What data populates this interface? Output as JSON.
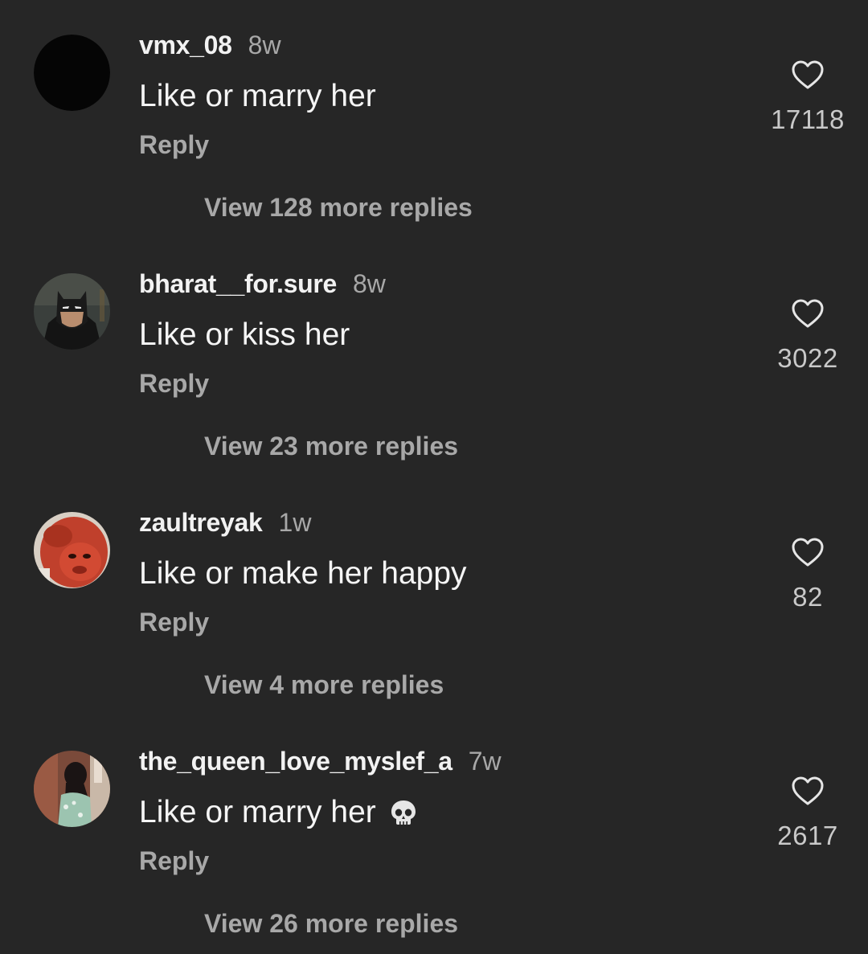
{
  "comments": [
    {
      "username": "vmx_08",
      "time": "8w",
      "text": "Like or marry her",
      "reply_label": "Reply",
      "likes": "17118",
      "more_replies": "View 128 more replies",
      "avatar": "black-circle-avatar",
      "emoji": ""
    },
    {
      "username": "bharat__for.sure",
      "time": "8w",
      "text": "Like or kiss her",
      "reply_label": "Reply",
      "likes": "3022",
      "more_replies": "View 23 more replies",
      "avatar": "batman-avatar",
      "emoji": ""
    },
    {
      "username": "zaultreyak",
      "time": "1w",
      "text": "Like or make her happy",
      "reply_label": "Reply",
      "likes": "82",
      "more_replies": "View 4 more replies",
      "avatar": "monkey-avatar",
      "emoji": ""
    },
    {
      "username": "the_queen_love_myslef_a",
      "time": "7w",
      "text": "Like or marry her",
      "reply_label": "Reply",
      "likes": "2617",
      "more_replies": "View 26 more replies",
      "avatar": "girl-photo-avatar",
      "emoji": "skull-emoji"
    }
  ],
  "colors": {
    "background": "#262626",
    "primary_text": "#f5f5f5",
    "secondary_text": "#a8a8a8"
  }
}
